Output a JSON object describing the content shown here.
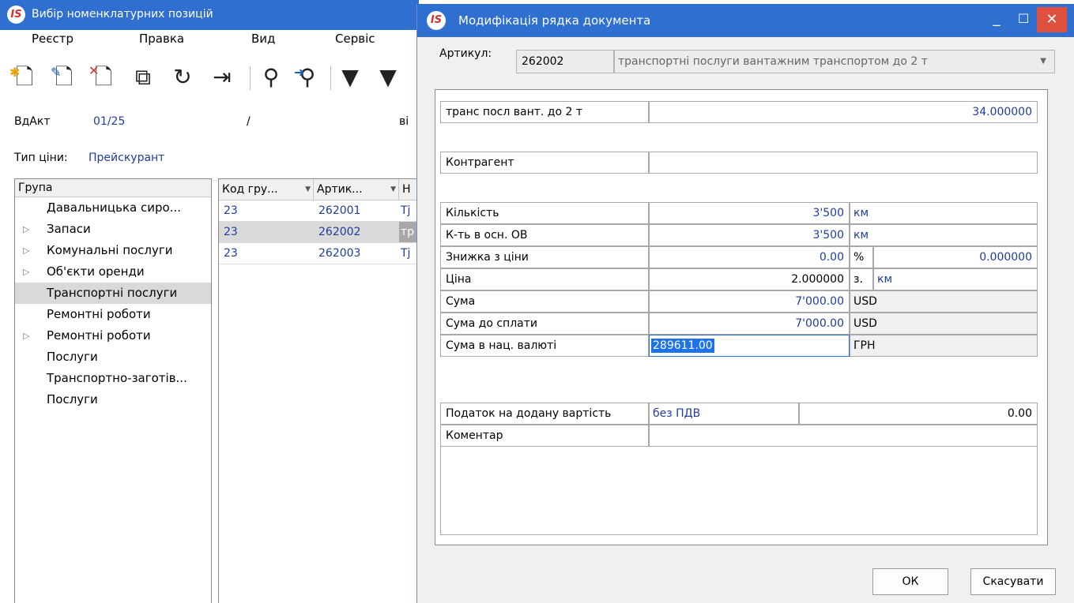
{
  "bg_window": {
    "title": "Вибір номенклатурних позицій",
    "menu": [
      "Реєстр",
      "Правка",
      "Вид",
      "Сервіс"
    ],
    "toolbar_icons": [
      "create-icon",
      "edit-icon",
      "delete-icon",
      "copy-icon",
      "refresh-icon",
      "export-icon",
      "search-icon",
      "search-next-icon",
      "filter-icon",
      "clear-filter-icon"
    ],
    "doc_type": "ВдАкт",
    "doc_number": "01/25",
    "doc_sep": "/",
    "doc_from": "ві",
    "price_type_label": "Тип ціни:",
    "price_type_value": "Прейскурант"
  },
  "groups": {
    "header": "Група",
    "items": [
      {
        "label": "Давальницька сиро...",
        "expandable": false
      },
      {
        "label": "Запаси",
        "expandable": true
      },
      {
        "label": "Комунальні послуги",
        "expandable": true
      },
      {
        "label": "Об'єкти оренди",
        "expandable": true
      },
      {
        "label": "Транспортні послуги",
        "expandable": false,
        "selected": true
      },
      {
        "label": "Ремонтні роботи",
        "expandable": false
      },
      {
        "label": "Ремонтні роботи",
        "expandable": true
      },
      {
        "label": "Послуги",
        "expandable": false
      },
      {
        "label": "Транспортно-заготів...",
        "expandable": false
      },
      {
        "label": "Послуги",
        "expandable": false
      }
    ]
  },
  "items_table": {
    "columns": [
      "Код гру...",
      "Артик...",
      "Н"
    ],
    "rows": [
      {
        "code": "23",
        "article": "262001",
        "name": "Тј"
      },
      {
        "code": "23",
        "article": "262002",
        "name": "тр",
        "selected": true
      },
      {
        "code": "23",
        "article": "262003",
        "name": "Тј"
      }
    ]
  },
  "dialog": {
    "title": "Модифікація рядка документа",
    "article_label": "Артикул:",
    "article_code": "262002",
    "article_name": "транспортні послуги вантажним транспортом до 2 т",
    "short_name": "транс посл  вант. до 2 т",
    "short_value": "34.000000",
    "counterparty_label": "Контрагент",
    "counterparty_value": "",
    "qty_label": "Кількість",
    "qty_value": "3'500",
    "qty_unit": "км",
    "qty_base_label": "К-ть в осн. ОВ",
    "qty_base_value": "3'500",
    "qty_base_unit": "км",
    "discount_label": "Знижка з ціни",
    "discount_value": "0.00",
    "discount_unit": "%",
    "discount_amount": "0.000000",
    "price_label": "Ціна",
    "price_value": "2.000000",
    "price_unit1": "з.",
    "price_unit2": "км",
    "sum_label": "Сума",
    "sum_value": "7'000.00",
    "sum_currency": "USD",
    "sum_pay_label": "Сума до сплати",
    "sum_pay_value": "7'000.00",
    "sum_pay_currency": "USD",
    "sum_nat_label": "Сума в нац. валюті",
    "sum_nat_value": "289611.00",
    "sum_nat_currency": "ГРН",
    "vat_label": "Податок на додану вартість",
    "vat_type": "без ПДВ",
    "vat_value": "0.00",
    "comment_label": "Коментар",
    "comment_value": "",
    "ok_label": "ОК",
    "cancel_label": "Скасувати"
  }
}
